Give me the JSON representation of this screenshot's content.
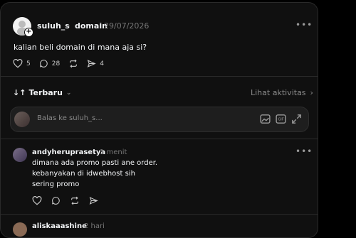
{
  "post": {
    "username": "suluh_s",
    "topic": "domain",
    "date": "29/07/2026",
    "text": "kalian beli domain di mana aja si?",
    "like_count": "5",
    "comment_count": "28",
    "share_count": "4"
  },
  "sort": {
    "label": "Terbaru",
    "activity_label": "Lihat aktivitas"
  },
  "reply": {
    "placeholder": "Balas ke suluh_s..."
  },
  "comments": [
    {
      "username": "andyheruprasetya",
      "time": "1 menit",
      "lines": [
        "dimana ada promo pasti ane order.",
        "kebanyakan di idwebhost sih",
        "sering promo"
      ]
    },
    {
      "username": "aliskaaashine",
      "time": "2 hari"
    }
  ],
  "icons": {
    "more": "more-horizontal-icon",
    "like": "heart-icon",
    "comment": "comment-icon",
    "repost": "repost-icon",
    "share": "send-icon",
    "image": "image-icon",
    "gif": "gif-icon",
    "expand": "expand-icon"
  },
  "colors": {
    "background": "#101010",
    "text": "#f3f5f7",
    "muted": "#777777",
    "border": "#2a2a2a"
  }
}
